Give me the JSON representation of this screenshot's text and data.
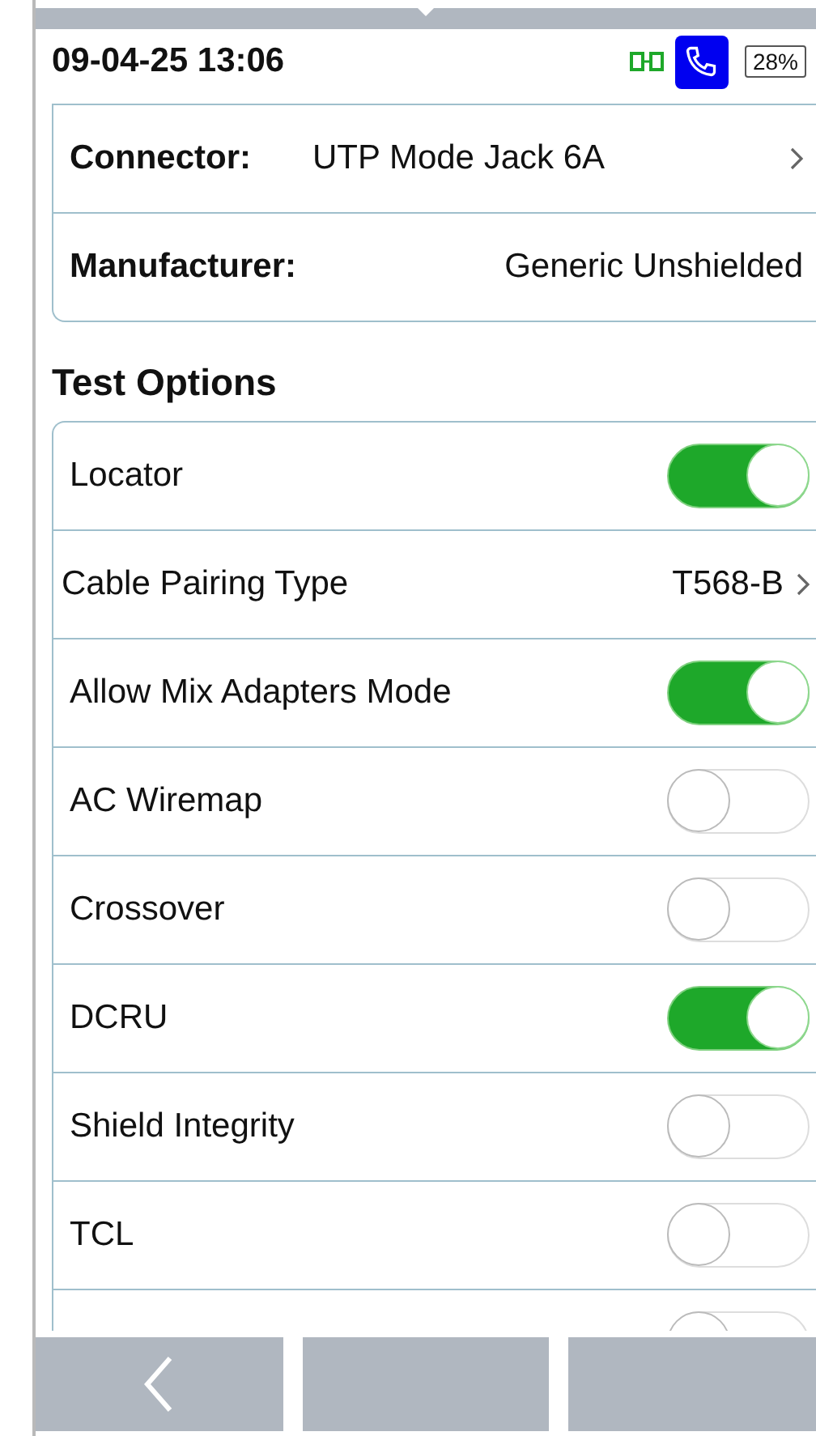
{
  "status_bar": {
    "datetime": "09-04-25 13:06",
    "battery": "28%"
  },
  "details": [
    {
      "label": "Connector:",
      "value": "UTP Mode Jack 6A",
      "chevron": true
    },
    {
      "label": "Manufacturer:",
      "value": "Generic Unshielded",
      "chevron": false
    }
  ],
  "test_options": {
    "title": "Test Options",
    "items": [
      {
        "kind": "toggle",
        "label": "Locator",
        "on": true
      },
      {
        "kind": "select",
        "label": "Cable Pairing Type",
        "value": "T568-B"
      },
      {
        "kind": "toggle",
        "label": "Allow Mix Adapters Mode",
        "on": true
      },
      {
        "kind": "toggle",
        "label": "AC Wiremap",
        "on": false
      },
      {
        "kind": "toggle",
        "label": "Crossover",
        "on": false
      },
      {
        "kind": "toggle",
        "label": "DCRU",
        "on": true
      },
      {
        "kind": "toggle",
        "label": "Shield Integrity",
        "on": false
      },
      {
        "kind": "toggle",
        "label": "TCL",
        "on": false
      },
      {
        "kind": "toggle",
        "on": false
      }
    ]
  },
  "bottom_buttons": [
    {
      "kind": "back"
    },
    {
      "kind": "blank"
    },
    {
      "kind": "blank"
    }
  ]
}
